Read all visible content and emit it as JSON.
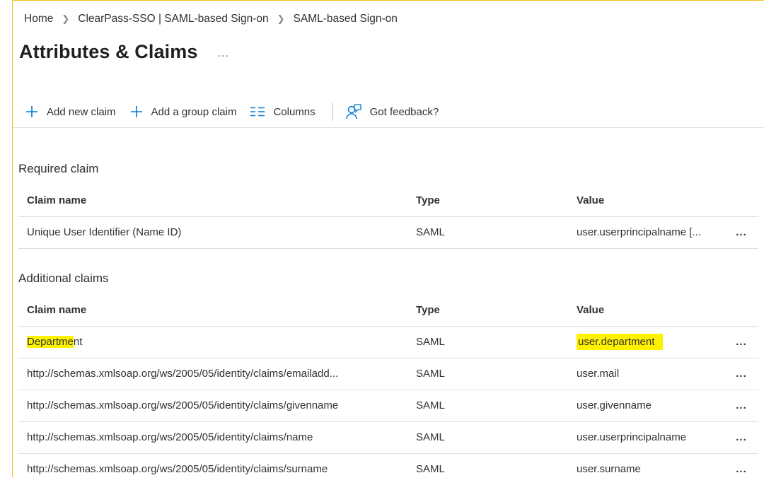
{
  "breadcrumb": {
    "items": [
      "Home",
      "ClearPass-SSO | SAML-based Sign-on",
      "SAML-based Sign-on"
    ]
  },
  "page": {
    "title": "Attributes & Claims",
    "more": "..."
  },
  "toolbar": {
    "add_claim": "Add new claim",
    "add_group_claim": "Add a group claim",
    "columns": "Columns",
    "feedback": "Got feedback?"
  },
  "required": {
    "section_title": "Required claim",
    "headers": {
      "name": "Claim name",
      "type": "Type",
      "value": "Value"
    },
    "rows": [
      {
        "name": "Unique User Identifier (Name ID)",
        "type": "SAML",
        "value": "user.userprincipalname [...",
        "more": "..."
      }
    ]
  },
  "additional": {
    "section_title": "Additional claims",
    "headers": {
      "name": "Claim name",
      "type": "Type",
      "value": "Value"
    },
    "rows": [
      {
        "name_hl": "Departme",
        "name_rest": "nt",
        "type": "SAML",
        "value": "user.department",
        "more": "..."
      },
      {
        "name": "http://schemas.xmlsoap.org/ws/2005/05/identity/claims/emailadd...",
        "type": "SAML",
        "value": "user.mail",
        "more": "..."
      },
      {
        "name": "http://schemas.xmlsoap.org/ws/2005/05/identity/claims/givenname",
        "type": "SAML",
        "value": "user.givenname",
        "more": "..."
      },
      {
        "name": "http://schemas.xmlsoap.org/ws/2005/05/identity/claims/name",
        "type": "SAML",
        "value": "user.userprincipalname",
        "more": "..."
      },
      {
        "name": "http://schemas.xmlsoap.org/ws/2005/05/identity/claims/surname",
        "type": "SAML",
        "value": "user.surname",
        "more": "..."
      }
    ]
  },
  "colors": {
    "accent": "#0078d4",
    "highlight": "#fff200",
    "frame": "#f2c21a"
  }
}
